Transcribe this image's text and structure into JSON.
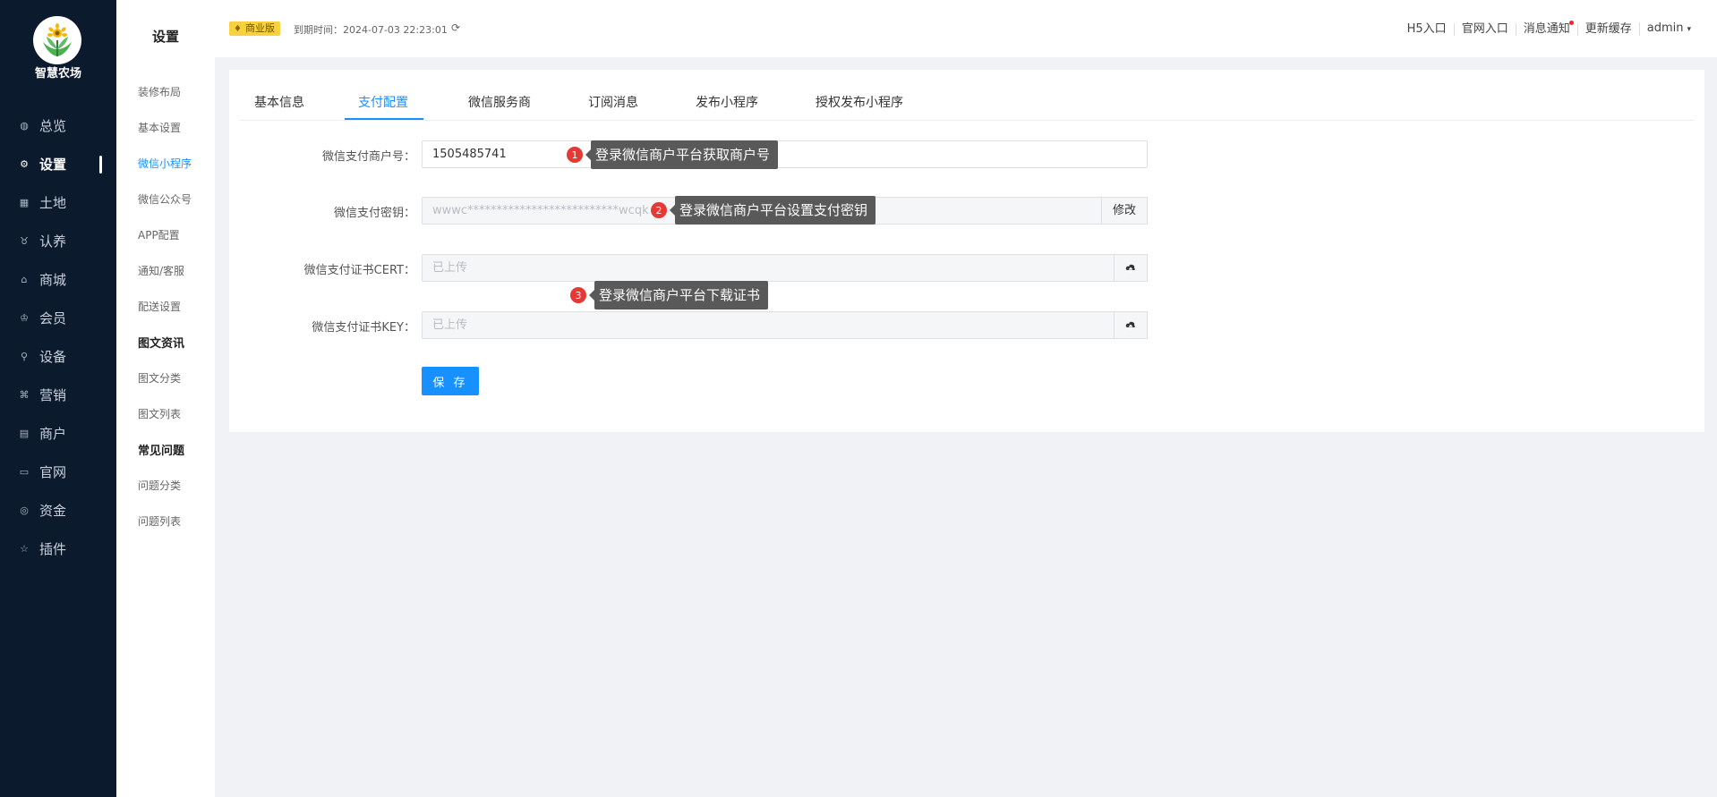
{
  "app": {
    "name": "智慧农场"
  },
  "sidebar": {
    "items": [
      {
        "label": "总览",
        "icon": "dashboard-icon"
      },
      {
        "label": "设置",
        "icon": "gear-icon",
        "active": true
      },
      {
        "label": "土地",
        "icon": "grid-icon"
      },
      {
        "label": "认养",
        "icon": "adopt-icon"
      },
      {
        "label": "商城",
        "icon": "shop-icon"
      },
      {
        "label": "会员",
        "icon": "member-icon"
      },
      {
        "label": "设备",
        "icon": "device-icon"
      },
      {
        "label": "营销",
        "icon": "marketing-icon"
      },
      {
        "label": "商户",
        "icon": "merchant-icon"
      },
      {
        "label": "官网",
        "icon": "website-icon"
      },
      {
        "label": "资金",
        "icon": "funds-icon"
      },
      {
        "label": "插件",
        "icon": "star-icon"
      }
    ]
  },
  "subnav": {
    "title": "设置",
    "items": [
      {
        "label": "装修布局"
      },
      {
        "label": "基本设置"
      },
      {
        "label": "微信小程序",
        "active": true
      },
      {
        "label": "微信公众号"
      },
      {
        "label": "APP配置"
      },
      {
        "label": "通知/客服"
      },
      {
        "label": "配送设置"
      }
    ],
    "groups": [
      {
        "title": "图文资讯",
        "items": [
          "图文分类",
          "图文列表"
        ]
      },
      {
        "title": "常见问题",
        "items": [
          "问题分类",
          "问题列表"
        ]
      }
    ]
  },
  "header": {
    "badge": "商业版",
    "expire_label": "到期时间：2024-07-03 22:23:01",
    "links": [
      "H5入口",
      "官网入口",
      "消息通知",
      "更新缓存"
    ],
    "user": "admin"
  },
  "tabs": [
    {
      "label": "基本信息"
    },
    {
      "label": "支付配置",
      "active": true
    },
    {
      "label": "微信服务商"
    },
    {
      "label": "订阅消息"
    },
    {
      "label": "发布小程序"
    },
    {
      "label": "授权发布小程序"
    }
  ],
  "form": {
    "mch_id": {
      "label": "微信支付商户号：",
      "value": "1505485741"
    },
    "pay_key": {
      "label": "微信支付密钥：",
      "value": "wwwc**************************wcqk",
      "addon": "修改"
    },
    "cert": {
      "label": "微信支付证书CERT：",
      "placeholder": "已上传"
    },
    "key": {
      "label": "微信支付证书KEY：",
      "placeholder": "已上传"
    },
    "save_label": "保 存"
  },
  "annotations": [
    {
      "num": "1",
      "text": "登录微信商户平台获取商户号"
    },
    {
      "num": "2",
      "text": "登录微信商户平台设置支付密钥"
    },
    {
      "num": "3",
      "text": "登录微信商户平台下载证书"
    }
  ],
  "colors": {
    "sidebar_bg": "#0c1a2e",
    "accent": "#1890ff",
    "badge": "#f7d23e",
    "annotation_num": "#e53935",
    "annotation_tip": "#595959"
  }
}
